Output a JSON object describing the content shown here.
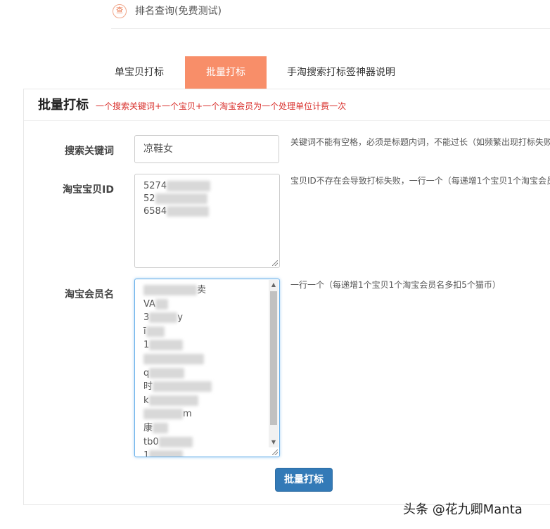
{
  "topbar": {
    "icon": "查",
    "text": "排名查询(免费测试)"
  },
  "tabs": [
    {
      "label": "单宝贝打标"
    },
    {
      "label": "批量打标"
    },
    {
      "label": "手淘搜索打标签神器说明"
    }
  ],
  "panel": {
    "title": "批量打标",
    "subtitle": "一个搜索关键词+一个宝贝+一个淘宝会员为一个处理单位计费一次"
  },
  "form": {
    "keyword": {
      "label": "搜索关键词",
      "value": "凉鞋女",
      "help": "关键词不能有空格，必须是标题内词，不能过长（如频繁出现打标失败"
    },
    "item_ids": {
      "label": "淘宝宝贝ID",
      "lines": [
        "5274",
        "52",
        "6584"
      ],
      "help": "宝贝ID不存在会导致打标失败，一行一个（每递增1个宝贝1个淘宝会员"
    },
    "members": {
      "label": "淘宝会员名",
      "lines": [
        "卖",
        "VA",
        "3",
        "y",
        "ī",
        "1",
        "q",
        "时",
        "k",
        "m",
        "康",
        "tb0",
        "1"
      ],
      "help": "一行一个（每递增1个宝贝1个淘宝会员名多扣5个猫币）"
    },
    "submit_label": "批量打标"
  },
  "watermark": "头条 @花九卿Manta",
  "colors": {
    "active_tab": "#f88e69",
    "button": "#337ab7",
    "hint": "#d9302c"
  }
}
